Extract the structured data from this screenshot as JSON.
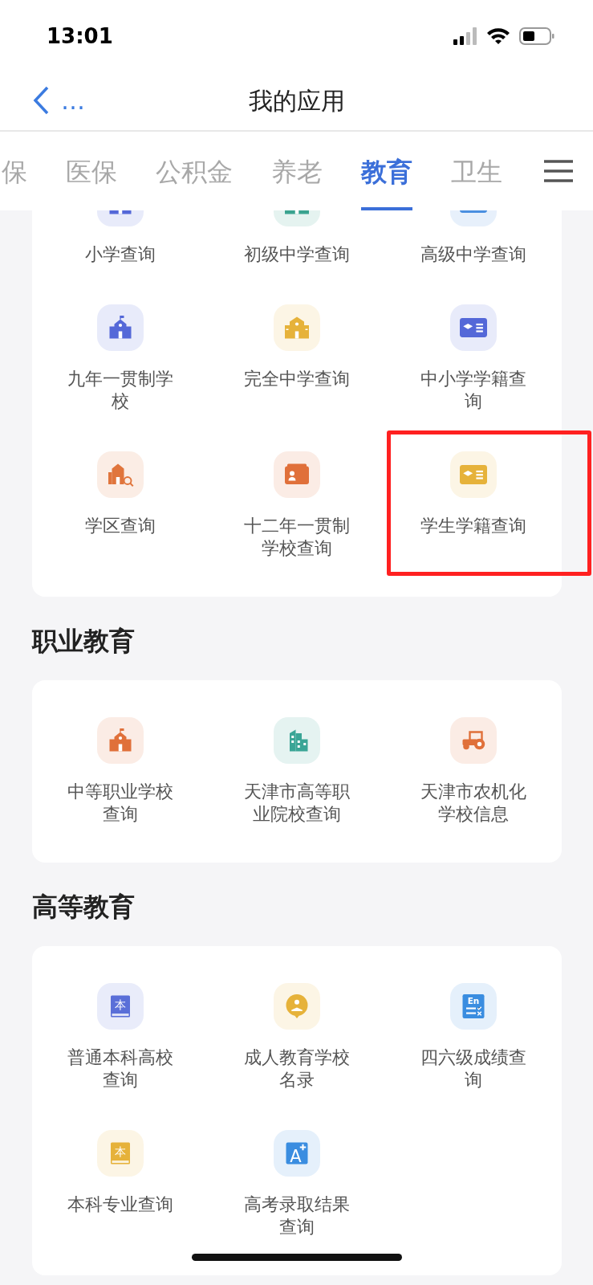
{
  "status_bar": {
    "time": "13:01"
  },
  "nav": {
    "back_label": "…",
    "title": "我的应用"
  },
  "tabs": [
    {
      "label": "保",
      "selected": false
    },
    {
      "label": "医保",
      "selected": false
    },
    {
      "label": "公积金",
      "selected": false
    },
    {
      "label": "养老",
      "selected": false
    },
    {
      "label": "教育",
      "selected": true
    },
    {
      "label": "卫生",
      "selected": false
    }
  ],
  "sections": [
    {
      "items": [
        {
          "label": "小学查询",
          "kind": "school",
          "color": "#5468d8",
          "highlighted": false
        },
        {
          "label": "初级中学查询",
          "kind": "building",
          "color": "#3aa38f",
          "highlighted": false
        },
        {
          "label": "高级中学查询",
          "kind": "card",
          "color": "#4a8fe0",
          "highlighted": false
        },
        {
          "label": "九年一贯制学校",
          "kind": "school",
          "color": "#5468d8",
          "highlighted": false
        },
        {
          "label": "完全中学查询",
          "kind": "building",
          "color": "#e6b23a",
          "highlighted": false
        },
        {
          "label": "中小学学籍查询",
          "kind": "card",
          "color": "#5468d8",
          "highlighted": false
        },
        {
          "label": "学区查询",
          "kind": "search-building",
          "color": "#e0753c",
          "highlighted": false
        },
        {
          "label": "十二年一贯制学校查询",
          "kind": "profile",
          "color": "#e0703a",
          "highlighted": false
        },
        {
          "label": "学生学籍查询",
          "kind": "card",
          "color": "#e6b23a",
          "highlighted": true
        }
      ]
    },
    {
      "title": "职业教育",
      "items": [
        {
          "label": "中等职业学校查询",
          "kind": "school",
          "color": "#e0703a",
          "highlighted": false
        },
        {
          "label": "天津市高等职业院校查询",
          "kind": "tower",
          "color": "#3aa596",
          "highlighted": false
        },
        {
          "label": "天津市农机化学校信息",
          "kind": "tractor",
          "color": "#e0703a",
          "highlighted": false
        }
      ]
    },
    {
      "title": "高等教育",
      "items": [
        {
          "label": "普通本科高校查询",
          "kind": "book",
          "glyph": "本",
          "color": "#5a6fd8",
          "highlighted": false
        },
        {
          "label": "成人教育学校名录",
          "kind": "reader",
          "color": "#e6b23a",
          "highlighted": false
        },
        {
          "label": "四六级成绩查询",
          "kind": "sheet",
          "glyph": "En",
          "color": "#3a8de0",
          "highlighted": false
        },
        {
          "label": "本科专业查询",
          "kind": "book",
          "glyph": "本",
          "color": "#e6b23a",
          "highlighted": false
        },
        {
          "label": "高考录取结果查询",
          "kind": "letter",
          "glyph": "A",
          "color": "#3a8de0",
          "highlighted": false
        }
      ]
    }
  ]
}
